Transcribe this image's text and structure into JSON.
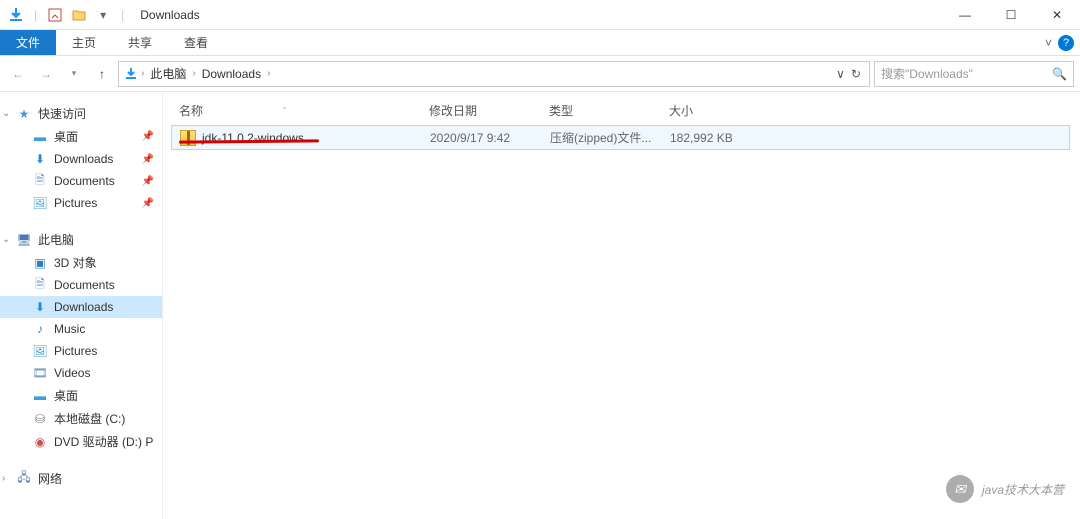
{
  "window": {
    "title": "Downloads",
    "controls": {
      "minimize": "—",
      "maximize": "☐",
      "close": "✕"
    }
  },
  "ribbon": {
    "file": "文件",
    "tabs": [
      "主页",
      "共享",
      "查看"
    ],
    "expand_icon": "chevron-down",
    "help_icon": "?"
  },
  "nav": {
    "back": "←",
    "forward": "→",
    "up": "↑"
  },
  "address": {
    "crumbs": [
      "此电脑",
      "Downloads"
    ],
    "refresh": "↻",
    "dropdown": "∨"
  },
  "search": {
    "placeholder": "搜索\"Downloads\"",
    "icon": "🔍"
  },
  "navpane": {
    "quick_access": {
      "label": "快速访问",
      "items": [
        {
          "label": "桌面",
          "icon": "desktop",
          "pinned": true
        },
        {
          "label": "Downloads",
          "icon": "downloads",
          "pinned": true
        },
        {
          "label": "Documents",
          "icon": "documents",
          "pinned": true
        },
        {
          "label": "Pictures",
          "icon": "pictures",
          "pinned": true
        }
      ]
    },
    "this_pc": {
      "label": "此电脑",
      "items": [
        {
          "label": "3D 对象",
          "icon": "3d"
        },
        {
          "label": "Documents",
          "icon": "documents"
        },
        {
          "label": "Downloads",
          "icon": "downloads",
          "selected": true
        },
        {
          "label": "Music",
          "icon": "music"
        },
        {
          "label": "Pictures",
          "icon": "pictures"
        },
        {
          "label": "Videos",
          "icon": "videos"
        },
        {
          "label": "桌面",
          "icon": "desktop"
        },
        {
          "label": "本地磁盘 (C:)",
          "icon": "drive"
        },
        {
          "label": "DVD 驱动器 (D:) P",
          "icon": "dvd"
        }
      ]
    },
    "network": {
      "label": "网络"
    }
  },
  "columns": {
    "name": "名称",
    "date": "修改日期",
    "type": "类型",
    "size": "大小"
  },
  "files": [
    {
      "name": "jdk-11.0.2-windows",
      "date": "2020/9/17 9:42",
      "type": "压缩(zipped)文件...",
      "size": "182,992 KB"
    }
  ],
  "watermark": "java技术大本营"
}
